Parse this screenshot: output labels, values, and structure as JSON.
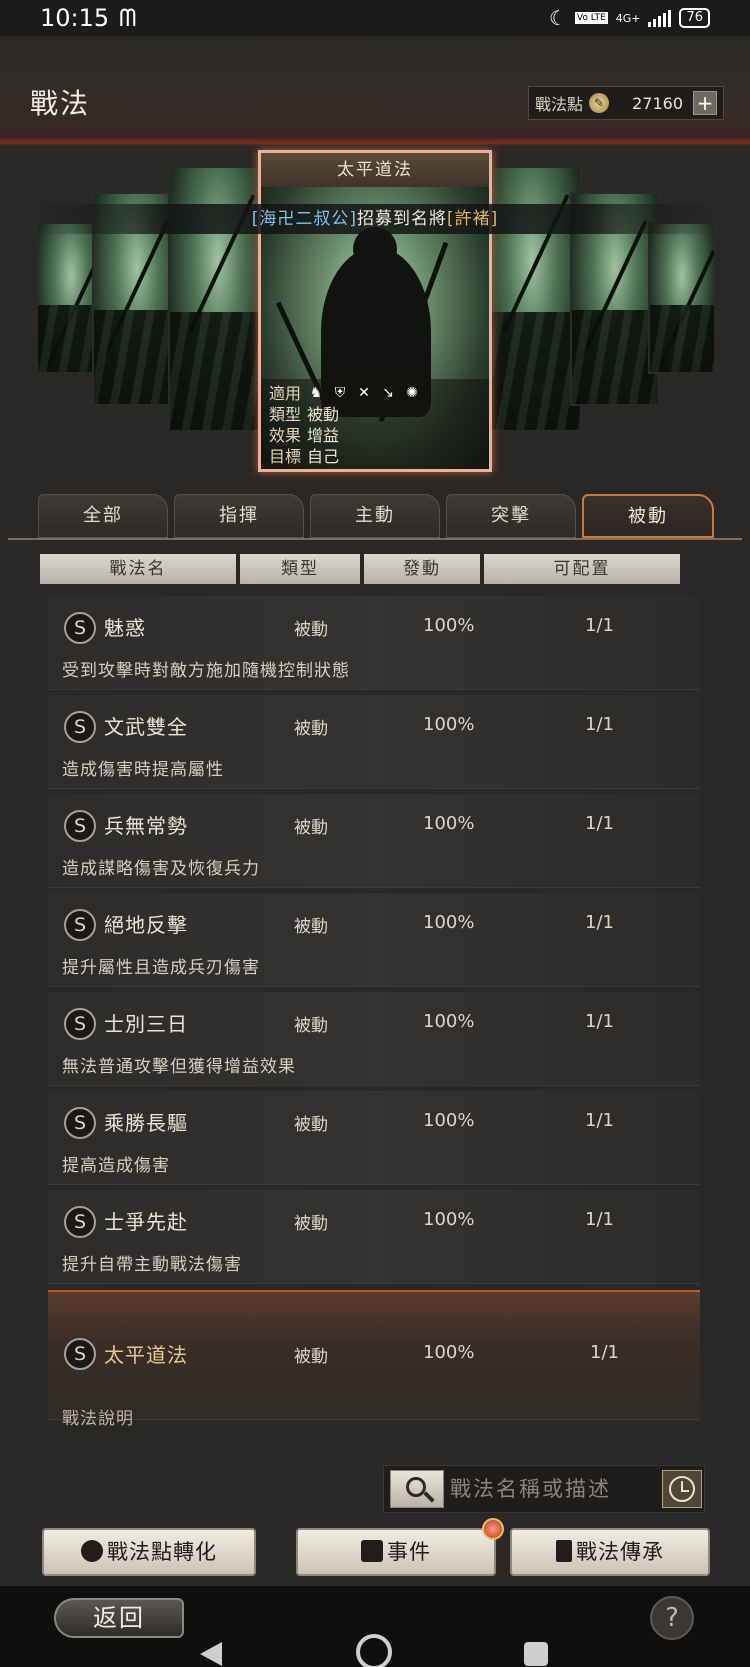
{
  "status_bar": {
    "time": "10:15",
    "app_icon": "mcdonalds-icon",
    "network": "4G+",
    "volte": "Vo LTE",
    "battery": "76"
  },
  "header": {
    "title": "戰法",
    "points_label": "戰法點",
    "points_value": "27160",
    "plus": "+"
  },
  "featured_card": {
    "title": "太平道法",
    "applicable_label": "適用",
    "applicable_icons": [
      "cavalry-icon",
      "shield-icon",
      "archer-icon",
      "spear-icon",
      "siege-icon"
    ],
    "type_label": "類型",
    "type_value": "被動",
    "effect_label": "效果",
    "effect_value": "增益",
    "target_label": "目標",
    "target_value": "自己"
  },
  "recruit_banner": {
    "player": "[海卍二叔公]",
    "text": "招募到名將",
    "general": "[許褚]"
  },
  "tabs": [
    {
      "label": "全部",
      "active": false
    },
    {
      "label": "指揮",
      "active": false
    },
    {
      "label": "主動",
      "active": false
    },
    {
      "label": "突擊",
      "active": false
    },
    {
      "label": "被動",
      "active": true
    }
  ],
  "columns": [
    "戰法名",
    "類型",
    "發動",
    "可配置"
  ],
  "tactics": [
    {
      "grade": "S",
      "name": "魅惑",
      "type": "被動",
      "rate": "100%",
      "slots": "1/1",
      "desc": "受到攻擊時對敵方施加隨機控制狀態"
    },
    {
      "grade": "S",
      "name": "文武雙全",
      "type": "被動",
      "rate": "100%",
      "slots": "1/1",
      "desc": "造成傷害時提高屬性"
    },
    {
      "grade": "S",
      "name": "兵無常勢",
      "type": "被動",
      "rate": "100%",
      "slots": "1/1",
      "desc": "造成謀略傷害及恢復兵力"
    },
    {
      "grade": "S",
      "name": "絕地反擊",
      "type": "被動",
      "rate": "100%",
      "slots": "1/1",
      "desc": "提升屬性且造成兵刃傷害"
    },
    {
      "grade": "S",
      "name": "士別三日",
      "type": "被動",
      "rate": "100%",
      "slots": "1/1",
      "desc": "無法普通攻擊但獲得增益效果"
    },
    {
      "grade": "S",
      "name": "乘勝長驅",
      "type": "被動",
      "rate": "100%",
      "slots": "1/1",
      "desc": "提高造成傷害"
    },
    {
      "grade": "S",
      "name": "士爭先赴",
      "type": "被動",
      "rate": "100%",
      "slots": "1/1",
      "desc": "提升自帶主動戰法傷害"
    },
    {
      "grade": "S",
      "name": "太平道法",
      "type": "被動",
      "rate": "100%",
      "slots": "1/1",
      "desc": "戰法說明",
      "selected": true
    }
  ],
  "search": {
    "placeholder": "戰法名稱或描述"
  },
  "buttons": {
    "convert": "戰法點轉化",
    "events": "事件",
    "inherit": "戰法傳承",
    "back": "返回",
    "help": "?"
  },
  "colors": {
    "accent": "#c77a3b",
    "selected_name": "#e6c992",
    "player_name": "#7ec3ee",
    "general_name": "#e3b65f"
  }
}
